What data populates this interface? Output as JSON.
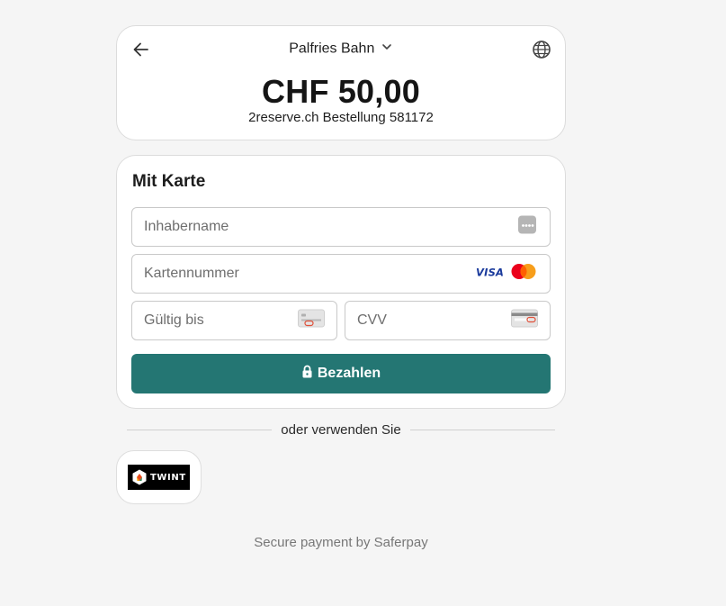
{
  "header": {
    "merchant": "Palfries Bahn",
    "amount": "CHF 50,00",
    "order": "2reserve.ch Bestellung 581172",
    "back_icon": "arrow-left-icon",
    "language_icon": "globe-icon"
  },
  "card_form": {
    "title": "Mit Karte",
    "holder_placeholder": "Inhabername",
    "number_placeholder": "Kartennummer",
    "expiry_placeholder": "Gültig bis",
    "cvv_placeholder": "CVV",
    "card_brands": [
      "VISA",
      "mastercard"
    ],
    "pay_label": "Bezahlen",
    "pay_color": "#247673"
  },
  "alternatives": {
    "divider_text": "oder verwenden Sie",
    "twint_label": "TWINT"
  },
  "footer": {
    "text": "Secure payment by Saferpay"
  }
}
